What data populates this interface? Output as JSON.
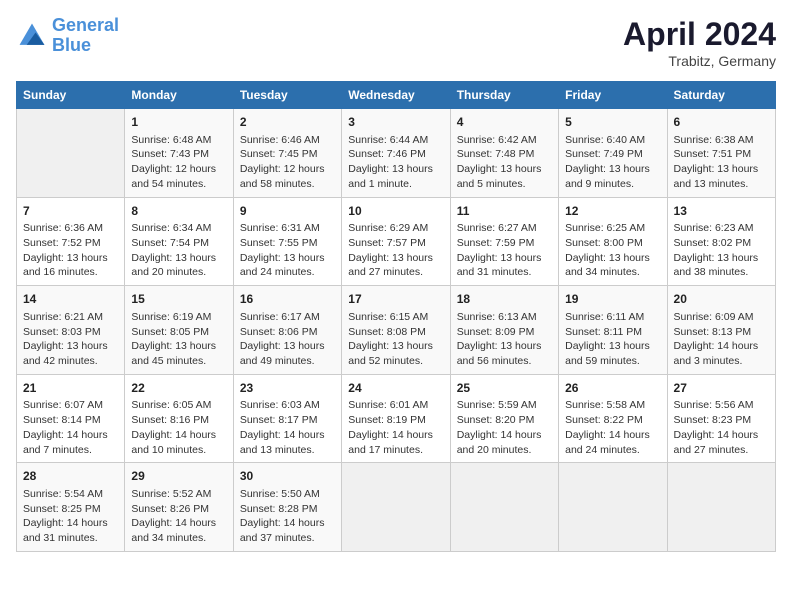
{
  "logo": {
    "line1": "General",
    "line2": "Blue"
  },
  "title": "April 2024",
  "subtitle": "Trabitz, Germany",
  "header_days": [
    "Sunday",
    "Monday",
    "Tuesday",
    "Wednesday",
    "Thursday",
    "Friday",
    "Saturday"
  ],
  "weeks": [
    [
      {
        "day": "",
        "info": ""
      },
      {
        "day": "1",
        "info": "Sunrise: 6:48 AM\nSunset: 7:43 PM\nDaylight: 12 hours\nand 54 minutes."
      },
      {
        "day": "2",
        "info": "Sunrise: 6:46 AM\nSunset: 7:45 PM\nDaylight: 12 hours\nand 58 minutes."
      },
      {
        "day": "3",
        "info": "Sunrise: 6:44 AM\nSunset: 7:46 PM\nDaylight: 13 hours\nand 1 minute."
      },
      {
        "day": "4",
        "info": "Sunrise: 6:42 AM\nSunset: 7:48 PM\nDaylight: 13 hours\nand 5 minutes."
      },
      {
        "day": "5",
        "info": "Sunrise: 6:40 AM\nSunset: 7:49 PM\nDaylight: 13 hours\nand 9 minutes."
      },
      {
        "day": "6",
        "info": "Sunrise: 6:38 AM\nSunset: 7:51 PM\nDaylight: 13 hours\nand 13 minutes."
      }
    ],
    [
      {
        "day": "7",
        "info": "Sunrise: 6:36 AM\nSunset: 7:52 PM\nDaylight: 13 hours\nand 16 minutes."
      },
      {
        "day": "8",
        "info": "Sunrise: 6:34 AM\nSunset: 7:54 PM\nDaylight: 13 hours\nand 20 minutes."
      },
      {
        "day": "9",
        "info": "Sunrise: 6:31 AM\nSunset: 7:55 PM\nDaylight: 13 hours\nand 24 minutes."
      },
      {
        "day": "10",
        "info": "Sunrise: 6:29 AM\nSunset: 7:57 PM\nDaylight: 13 hours\nand 27 minutes."
      },
      {
        "day": "11",
        "info": "Sunrise: 6:27 AM\nSunset: 7:59 PM\nDaylight: 13 hours\nand 31 minutes."
      },
      {
        "day": "12",
        "info": "Sunrise: 6:25 AM\nSunset: 8:00 PM\nDaylight: 13 hours\nand 34 minutes."
      },
      {
        "day": "13",
        "info": "Sunrise: 6:23 AM\nSunset: 8:02 PM\nDaylight: 13 hours\nand 38 minutes."
      }
    ],
    [
      {
        "day": "14",
        "info": "Sunrise: 6:21 AM\nSunset: 8:03 PM\nDaylight: 13 hours\nand 42 minutes."
      },
      {
        "day": "15",
        "info": "Sunrise: 6:19 AM\nSunset: 8:05 PM\nDaylight: 13 hours\nand 45 minutes."
      },
      {
        "day": "16",
        "info": "Sunrise: 6:17 AM\nSunset: 8:06 PM\nDaylight: 13 hours\nand 49 minutes."
      },
      {
        "day": "17",
        "info": "Sunrise: 6:15 AM\nSunset: 8:08 PM\nDaylight: 13 hours\nand 52 minutes."
      },
      {
        "day": "18",
        "info": "Sunrise: 6:13 AM\nSunset: 8:09 PM\nDaylight: 13 hours\nand 56 minutes."
      },
      {
        "day": "19",
        "info": "Sunrise: 6:11 AM\nSunset: 8:11 PM\nDaylight: 13 hours\nand 59 minutes."
      },
      {
        "day": "20",
        "info": "Sunrise: 6:09 AM\nSunset: 8:13 PM\nDaylight: 14 hours\nand 3 minutes."
      }
    ],
    [
      {
        "day": "21",
        "info": "Sunrise: 6:07 AM\nSunset: 8:14 PM\nDaylight: 14 hours\nand 7 minutes."
      },
      {
        "day": "22",
        "info": "Sunrise: 6:05 AM\nSunset: 8:16 PM\nDaylight: 14 hours\nand 10 minutes."
      },
      {
        "day": "23",
        "info": "Sunrise: 6:03 AM\nSunset: 8:17 PM\nDaylight: 14 hours\nand 13 minutes."
      },
      {
        "day": "24",
        "info": "Sunrise: 6:01 AM\nSunset: 8:19 PM\nDaylight: 14 hours\nand 17 minutes."
      },
      {
        "day": "25",
        "info": "Sunrise: 5:59 AM\nSunset: 8:20 PM\nDaylight: 14 hours\nand 20 minutes."
      },
      {
        "day": "26",
        "info": "Sunrise: 5:58 AM\nSunset: 8:22 PM\nDaylight: 14 hours\nand 24 minutes."
      },
      {
        "day": "27",
        "info": "Sunrise: 5:56 AM\nSunset: 8:23 PM\nDaylight: 14 hours\nand 27 minutes."
      }
    ],
    [
      {
        "day": "28",
        "info": "Sunrise: 5:54 AM\nSunset: 8:25 PM\nDaylight: 14 hours\nand 31 minutes."
      },
      {
        "day": "29",
        "info": "Sunrise: 5:52 AM\nSunset: 8:26 PM\nDaylight: 14 hours\nand 34 minutes."
      },
      {
        "day": "30",
        "info": "Sunrise: 5:50 AM\nSunset: 8:28 PM\nDaylight: 14 hours\nand 37 minutes."
      },
      {
        "day": "",
        "info": ""
      },
      {
        "day": "",
        "info": ""
      },
      {
        "day": "",
        "info": ""
      },
      {
        "day": "",
        "info": ""
      }
    ]
  ]
}
